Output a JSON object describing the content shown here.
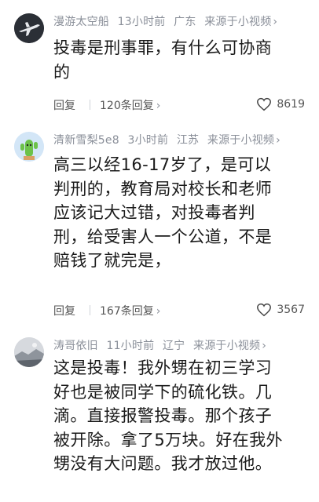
{
  "comments": [
    {
      "username": "漫游太空船",
      "time": "13小时前",
      "location": "广东",
      "source": "来源于小视频",
      "lines": [
        "投毒是刑事罪，有什么可协商",
        "的"
      ],
      "reply_label": "回复",
      "reply_count": "120条回复",
      "likes": "8619",
      "avatar_icon": "airplane-avatar"
    },
    {
      "username": "清新雪梨5e8",
      "time": "3小时前",
      "location": "江苏",
      "source": "来源于小视频",
      "lines": [
        "高三以经16-17岁了，是可以",
        "判刑的，教育局对校长和老师",
        "应该记大过错，对投毒者判",
        "刑，给受害人一个公道，不是",
        "赔钱了就完是，"
      ],
      "reply_label": "回复",
      "reply_count": "167条回复",
      "likes": "3567",
      "avatar_icon": "cactus-avatar"
    },
    {
      "username": "涛哥依旧",
      "time": "11小时前",
      "location": "辽宁",
      "source": "来源于小视频",
      "lines": [
        "这是投毒！我外甥在初三学习",
        "好也是被同学下的硫化铁。几",
        "滴。直接报警投毒。那个孩子",
        "被开除。拿了5万块。好在我外",
        "甥没有大问题。我才放过他。"
      ],
      "avatar_icon": "landscape-avatar"
    }
  ],
  "icons": {
    "chevron": "chevron-right-icon",
    "like": "heart-icon"
  },
  "chevron_glyph": "›"
}
